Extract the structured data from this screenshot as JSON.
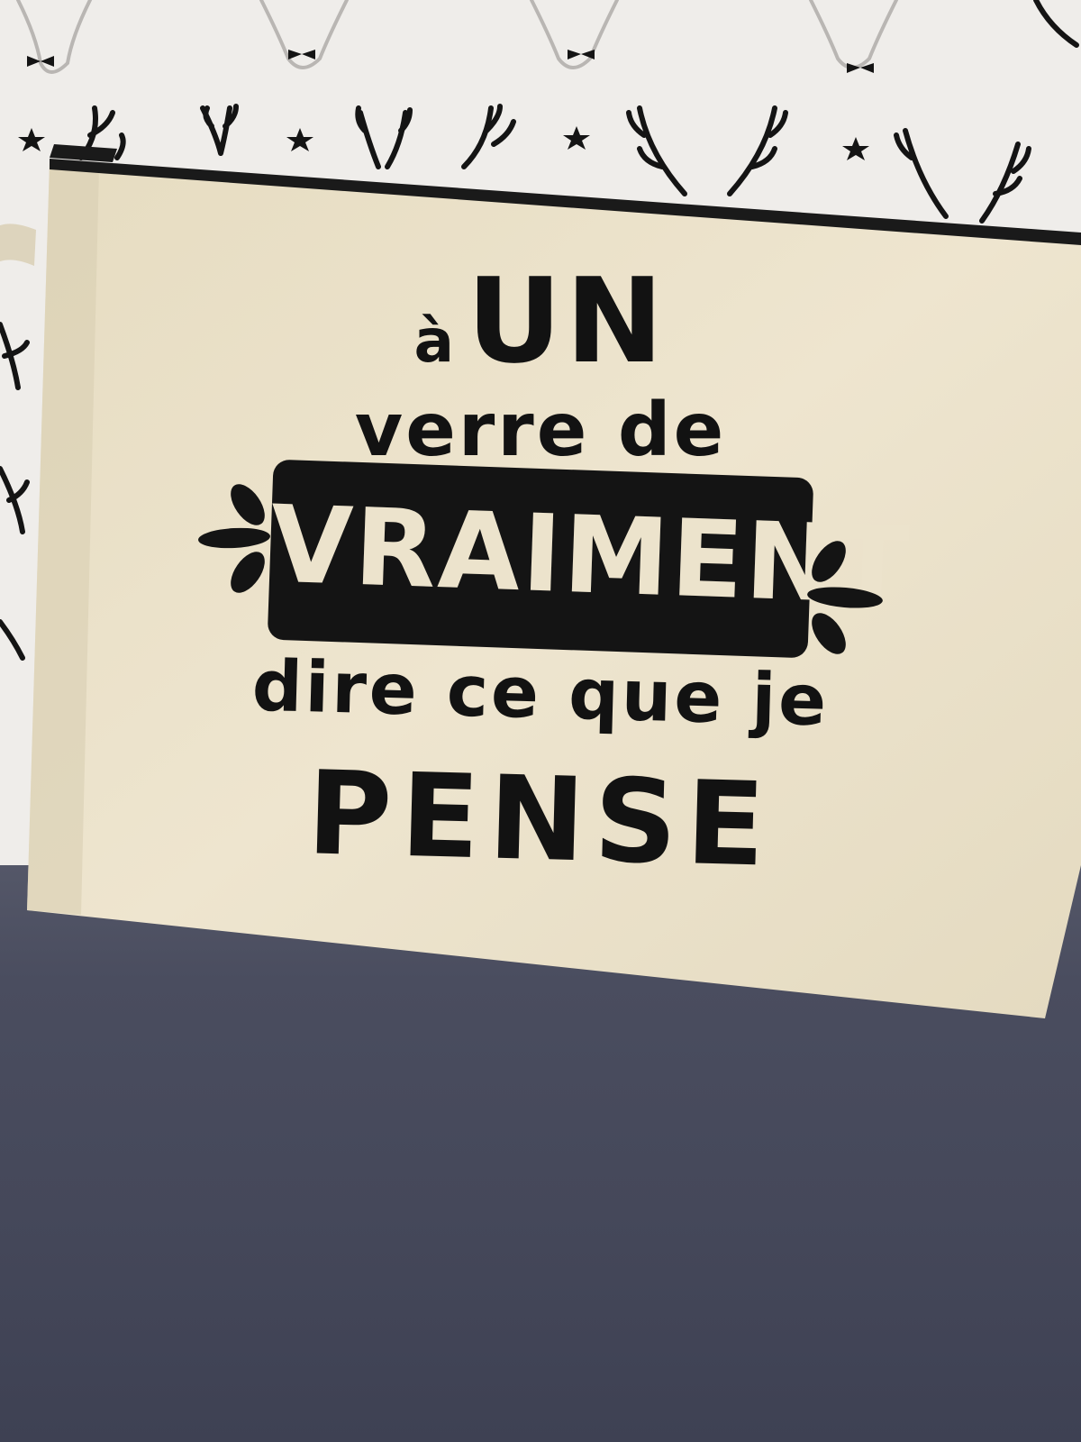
{
  "pouch_text": {
    "line1_small": "à",
    "line1_big": "UN",
    "line2": "verre de",
    "banner": "VRAIMENT",
    "line3": "dire ce que je",
    "line4": "PENSE"
  },
  "colors": {
    "fabric_background": "#efedea",
    "pattern_ink": "#141414",
    "canvas_pouch": "#ece3cc",
    "seat": "#45485a",
    "print_ink": "#121212"
  }
}
